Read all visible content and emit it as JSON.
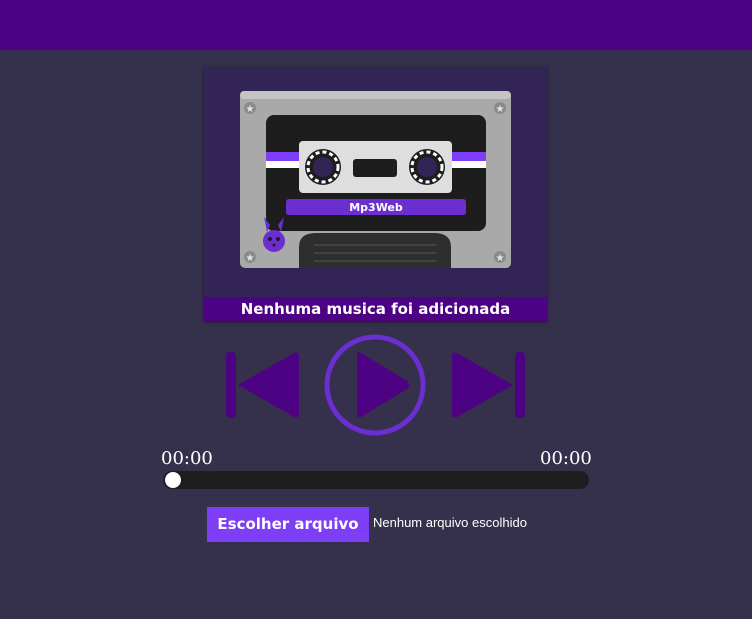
{
  "colors": {
    "top_bar": "#4c0283",
    "background": "#35304b",
    "card": "#322454",
    "accent": "#4c0283",
    "accent_light": "#7d3ef5",
    "track": "#1f1e1f"
  },
  "player": {
    "cassette_label": "Mp3Web",
    "song_title": "Nenhuma musica foi adicionada",
    "current_time": "00:00",
    "total_time": "00:00",
    "progress": 0
  },
  "file_input": {
    "button_label": "Escolher arquivo",
    "status": "Nenhum arquivo escolhido"
  },
  "icons": {
    "logo": "bunny-logo-icon",
    "previous": "skip-previous-icon",
    "play": "play-icon",
    "next": "skip-next-icon"
  }
}
